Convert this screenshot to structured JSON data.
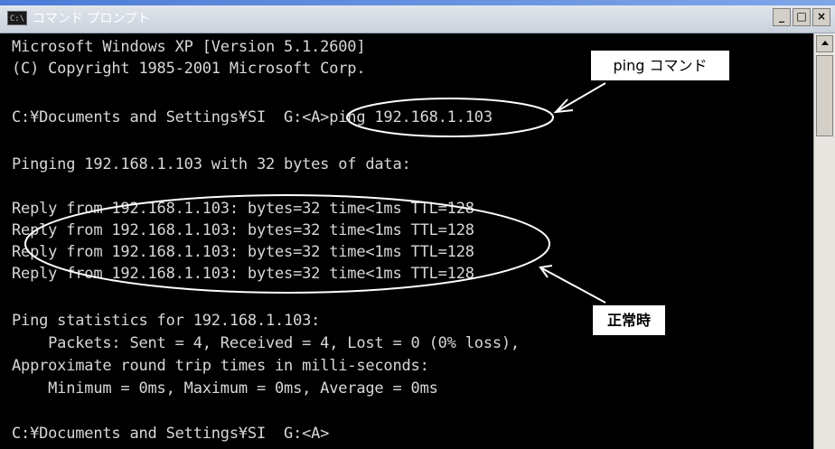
{
  "window": {
    "title": "コマンド プロンプト",
    "app_icon_text": "C:\\",
    "controls": {
      "minimize": "_",
      "maximize": "□",
      "close": "×"
    }
  },
  "console": {
    "lines": [
      "Microsoft Windows XP [Version 5.1.2600]",
      "(C) Copyright 1985-2001 Microsoft Corp.",
      "",
      "C:¥Documents and Settings¥SI  G:<A>ping 192.168.1.103",
      "",
      "Pinging 192.168.1.103 with 32 bytes of data:",
      "",
      "Reply from 192.168.1.103: bytes=32 time<1ms TTL=128",
      "Reply from 192.168.1.103: bytes=32 time<1ms TTL=128",
      "Reply from 192.168.1.103: bytes=32 time<1ms TTL=128",
      "Reply from 192.168.1.103: bytes=32 time<1ms TTL=128",
      "",
      "Ping statistics for 192.168.1.103:",
      "    Packets: Sent = 4, Received = 4, Lost = 0 (0% loss),",
      "Approximate round trip times in milli-seconds:",
      "    Minimum = 0ms, Maximum = 0ms, Average = 0ms",
      "",
      "C:¥Documents and Settings¥SI  G:<A>"
    ]
  },
  "annotations": {
    "ping_command_label": "ping コマンド",
    "normal_label": "正常時"
  },
  "colors": {
    "console_background": "#000000",
    "console_text": "#d8d8d8",
    "callout_background": "#ffffff",
    "annotation_stroke": "#ffffff"
  }
}
